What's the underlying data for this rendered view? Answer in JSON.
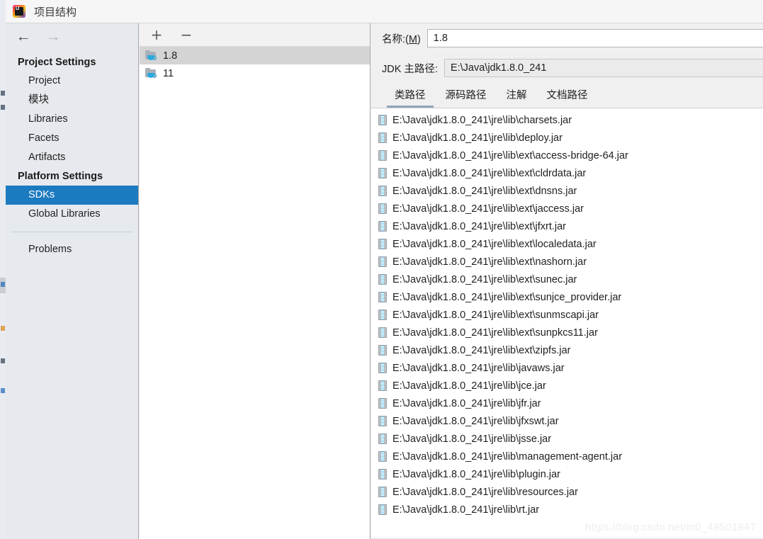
{
  "window": {
    "title": "项目结构",
    "logo_icon": "intellij-idea-logo"
  },
  "nav": {
    "back_icon": "arrow-left-icon",
    "forward_icon": "arrow-right-icon"
  },
  "sidebar": {
    "groups": [
      {
        "label": "Project Settings",
        "items": [
          {
            "label": "Project",
            "selected": false
          },
          {
            "label": "模块",
            "selected": false
          },
          {
            "label": "Libraries",
            "selected": false
          },
          {
            "label": "Facets",
            "selected": false
          },
          {
            "label": "Artifacts",
            "selected": false
          }
        ]
      },
      {
        "label": "Platform Settings",
        "items": [
          {
            "label": "SDKs",
            "selected": true
          },
          {
            "label": "Global Libraries",
            "selected": false
          }
        ]
      }
    ],
    "footer_items": [
      {
        "label": "Problems",
        "selected": false
      }
    ]
  },
  "sdk_panel": {
    "toolbar": {
      "add_label": "+",
      "add_icon": "plus-icon",
      "remove_label": "−",
      "remove_icon": "minus-icon"
    },
    "items": [
      {
        "label": "1.8",
        "selected": true,
        "icon": "java-sdk-folder-icon"
      },
      {
        "label": "11",
        "selected": false,
        "icon": "java-sdk-folder-icon"
      }
    ]
  },
  "detail": {
    "name_label_prefix": "名称:(",
    "name_label_mnemonic": "M",
    "name_label_suffix": ")",
    "name_value": "1.8",
    "home_label": "JDK 主路径:",
    "home_value": "E:\\Java\\jdk1.8.0_241",
    "tabs": [
      {
        "label": "类路径",
        "active": true
      },
      {
        "label": "源码路径",
        "active": false
      },
      {
        "label": "注解",
        "active": false
      },
      {
        "label": "文档路径",
        "active": false
      }
    ],
    "classpath_entries": [
      "E:\\Java\\jdk1.8.0_241\\jre\\lib\\charsets.jar",
      "E:\\Java\\jdk1.8.0_241\\jre\\lib\\deploy.jar",
      "E:\\Java\\jdk1.8.0_241\\jre\\lib\\ext\\access-bridge-64.jar",
      "E:\\Java\\jdk1.8.0_241\\jre\\lib\\ext\\cldrdata.jar",
      "E:\\Java\\jdk1.8.0_241\\jre\\lib\\ext\\dnsns.jar",
      "E:\\Java\\jdk1.8.0_241\\jre\\lib\\ext\\jaccess.jar",
      "E:\\Java\\jdk1.8.0_241\\jre\\lib\\ext\\jfxrt.jar",
      "E:\\Java\\jdk1.8.0_241\\jre\\lib\\ext\\localedata.jar",
      "E:\\Java\\jdk1.8.0_241\\jre\\lib\\ext\\nashorn.jar",
      "E:\\Java\\jdk1.8.0_241\\jre\\lib\\ext\\sunec.jar",
      "E:\\Java\\jdk1.8.0_241\\jre\\lib\\ext\\sunjce_provider.jar",
      "E:\\Java\\jdk1.8.0_241\\jre\\lib\\ext\\sunmscapi.jar",
      "E:\\Java\\jdk1.8.0_241\\jre\\lib\\ext\\sunpkcs11.jar",
      "E:\\Java\\jdk1.8.0_241\\jre\\lib\\ext\\zipfs.jar",
      "E:\\Java\\jdk1.8.0_241\\jre\\lib\\javaws.jar",
      "E:\\Java\\jdk1.8.0_241\\jre\\lib\\jce.jar",
      "E:\\Java\\jdk1.8.0_241\\jre\\lib\\jfr.jar",
      "E:\\Java\\jdk1.8.0_241\\jre\\lib\\jfxswt.jar",
      "E:\\Java\\jdk1.8.0_241\\jre\\lib\\jsse.jar",
      "E:\\Java\\jdk1.8.0_241\\jre\\lib\\management-agent.jar",
      "E:\\Java\\jdk1.8.0_241\\jre\\lib\\plugin.jar",
      "E:\\Java\\jdk1.8.0_241\\jre\\lib\\resources.jar",
      "E:\\Java\\jdk1.8.0_241\\jre\\lib\\rt.jar"
    ]
  },
  "watermark": {
    "text": "https://blog.csdn.net/m0_49501947"
  },
  "colors": {
    "selection_blue": "#1c7ac0",
    "row_selection_gray": "#d4d4d4",
    "sidebar_bg": "#e6eaee",
    "panel_bg": "#f0f0f0",
    "tab_underline": "#8fa4b8"
  }
}
